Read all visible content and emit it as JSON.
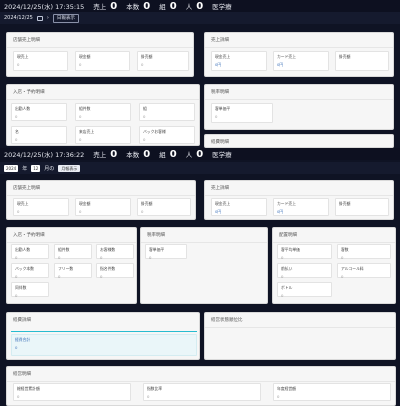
{
  "header1": {
    "datetime": "2024/12/25(水) 17:35:15",
    "sales_label": "売上",
    "sales": "0",
    "count_label": "本数",
    "count": "0",
    "group_label": "組",
    "group": "0",
    "people_label": "人",
    "people": "0",
    "user": "医学療",
    "date": "2024/12/25",
    "button": "日報表示"
  },
  "header2": {
    "datetime": "2024/12/25(水) 17:36:22",
    "sales_label": "売上",
    "sales": "0",
    "count_label": "本数",
    "count": "0",
    "group_label": "組",
    "group": "0",
    "people_label": "人",
    "people": "0",
    "user": "医学療",
    "year": "2024",
    "year_unit": "年",
    "month": "12",
    "month_unit": "月の",
    "button": "月報表示"
  },
  "top": {
    "sales_title": "店舗売上明細",
    "sales_cells": [
      {
        "label": "現売上",
        "value": "0"
      },
      {
        "label": "現金額",
        "value": "0"
      },
      {
        "label": "掛売額",
        "value": "0"
      }
    ],
    "upper_title": "売上詳細",
    "upper_cells": [
      {
        "label": "現金売上",
        "value": "0円"
      },
      {
        "label": "カード売上",
        "value": "0円"
      },
      {
        "label": "掛売額",
        "value": ""
      }
    ],
    "visit_title": "入店・予約明細",
    "visit_cells": [
      {
        "label": "出勤人数",
        "value": "0"
      },
      {
        "label": "組件数",
        "value": "0"
      },
      {
        "label": "組",
        "value": "0"
      },
      {
        "label": "名",
        "value": "0"
      },
      {
        "label": "来店売上",
        "value": "0"
      },
      {
        "label": "バックお客様",
        "value": "0"
      }
    ],
    "tax_title": "税率明細",
    "tax_cells": [
      {
        "label": "客単価平",
        "value": "0"
      }
    ],
    "other_title": "経費明細"
  },
  "bottom": {
    "sales_title": "店舗売上明細",
    "sales_cells": [
      {
        "label": "現売上",
        "value": "0"
      },
      {
        "label": "現金額",
        "value": "0"
      },
      {
        "label": "掛売額",
        "value": "0"
      }
    ],
    "upper_title": "売上詳細",
    "upper_cells": [
      {
        "label": "現金売上",
        "value": "0円"
      },
      {
        "label": "カード売上",
        "value": "0円"
      },
      {
        "label": "掛売額",
        "value": ""
      }
    ],
    "visit_title": "入店・予約明細",
    "visit_cells": [
      {
        "label": "出勤人数",
        "value": "0"
      },
      {
        "label": "組件数",
        "value": "0"
      },
      {
        "label": "お客様数",
        "value": "0"
      },
      {
        "label": "バック本数",
        "value": "0"
      },
      {
        "label": "フリー数",
        "value": "0"
      },
      {
        "label": "指名件数",
        "value": "0"
      },
      {
        "label": "同伴数",
        "value": "0"
      }
    ],
    "tax_title": "税率明細",
    "tax_cells": [
      {
        "label": "客単価平",
        "value": "0"
      }
    ],
    "cast_title": "配置明細",
    "cast_cells": [
      {
        "label": "客平均単価",
        "value": "0"
      },
      {
        "label": "客数",
        "value": "0"
      },
      {
        "label": "前払い",
        "value": "0"
      },
      {
        "label": "アルコール料",
        "value": "0"
      },
      {
        "label": "ボトル",
        "value": "0"
      }
    ],
    "expense_title": "経費詳細",
    "expense_cell": {
      "label": "経費合計",
      "value": "0"
    },
    "ranking_title": "経営状態順位比",
    "misc_title": "経営明細",
    "misc_cells": [
      {
        "label": "総経営累計額",
        "value": "0"
      },
      {
        "label": "指数比率",
        "value": "0"
      },
      {
        "label": "年度経営額",
        "value": "0"
      }
    ]
  }
}
